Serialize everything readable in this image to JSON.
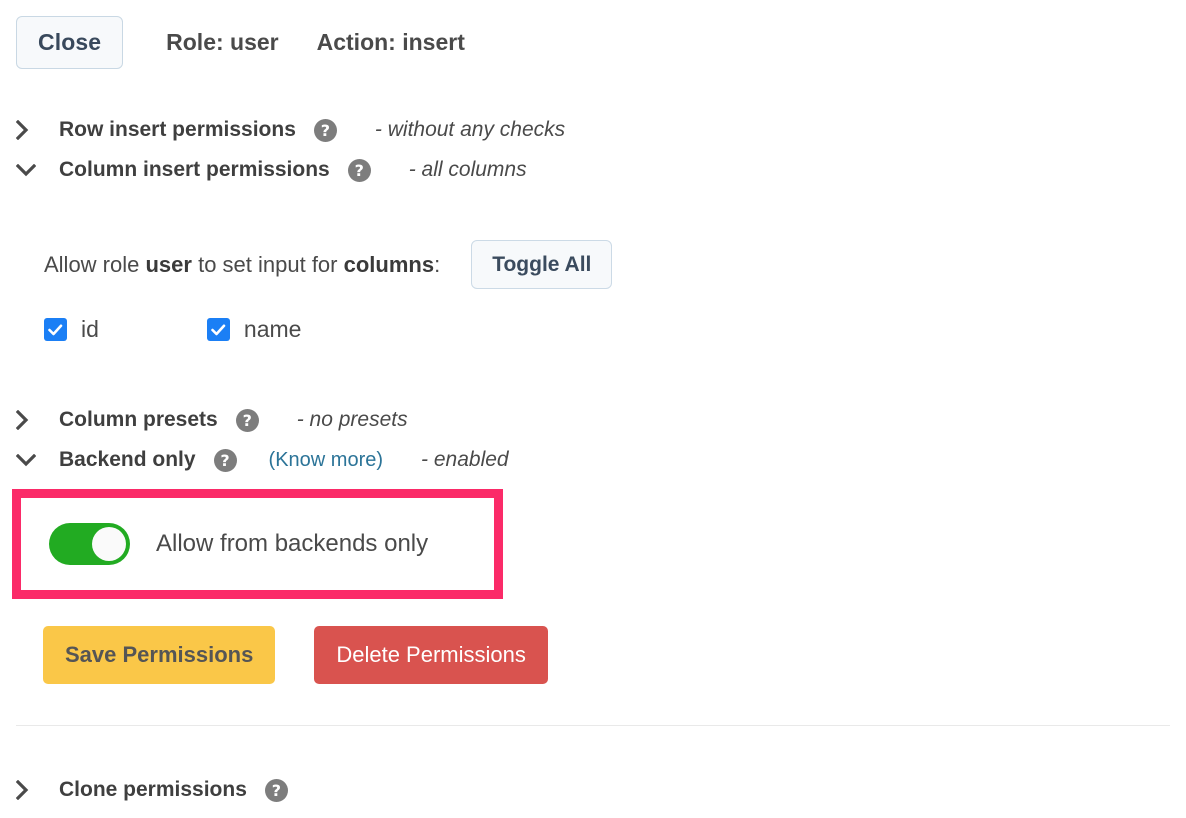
{
  "header": {
    "close_label": "Close",
    "role_label": "Role: user",
    "action_label": "Action: insert"
  },
  "icons": {
    "chevron_right": "chevron-right-icon",
    "chevron_down": "chevron-down-icon",
    "help": "?",
    "check": "check-icon"
  },
  "sections": {
    "row_insert": {
      "title": "Row insert permissions",
      "note": "- without any checks",
      "state": "collapsed"
    },
    "column_insert": {
      "title": "Column insert permissions",
      "note": "- all columns",
      "state": "expanded",
      "allow_prefix": "Allow role ",
      "allow_role": "user",
      "allow_middle": " to set input for ",
      "allow_target": "columns",
      "allow_suffix": ":",
      "toggle_all_label": "Toggle All",
      "columns": [
        {
          "name": "id",
          "checked": true
        },
        {
          "name": "name",
          "checked": true
        }
      ]
    },
    "column_presets": {
      "title": "Column presets",
      "note": "- no presets",
      "state": "collapsed"
    },
    "backend_only": {
      "title": "Backend only",
      "link_label": "(Know more)",
      "note": "- enabled",
      "state": "expanded",
      "switch_label": "Allow from backends only",
      "switch_on": true
    },
    "clone_permissions": {
      "title": "Clone permissions",
      "state": "collapsed"
    }
  },
  "actions": {
    "save_label": "Save Permissions",
    "delete_label": "Delete Permissions"
  },
  "colors": {
    "highlight": "#fb2a68",
    "switch_on": "#22ab22",
    "checkbox": "#1b7ff5",
    "save": "#fac748",
    "delete": "#d9534f",
    "link": "#2c7498"
  }
}
